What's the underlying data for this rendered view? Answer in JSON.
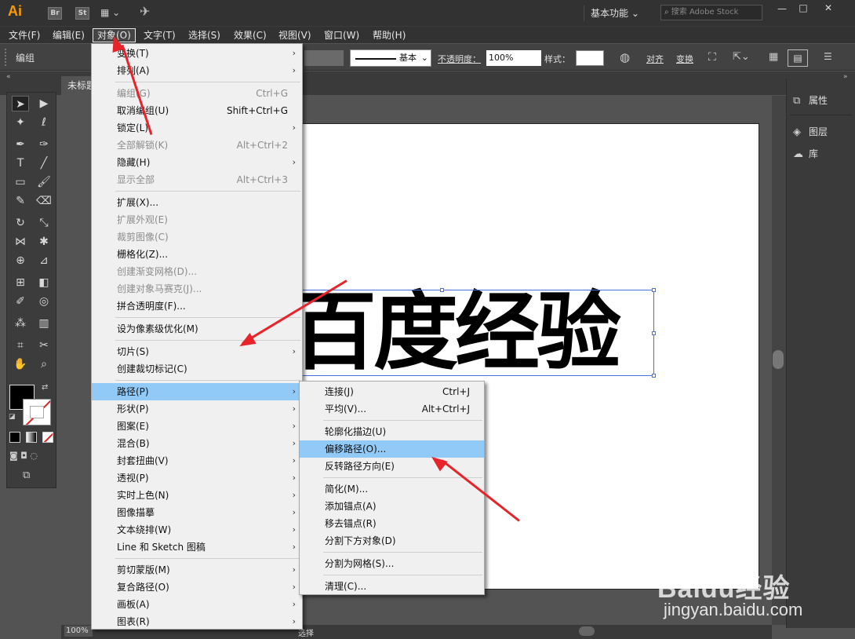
{
  "app": {
    "logo": "Ai",
    "br": "Br",
    "st": "St",
    "workspace": "基本功能",
    "search_placeholder": "搜索 Adobe Stock",
    "min": "—",
    "max": "□",
    "close": "✕"
  },
  "menubar": [
    "文件(F)",
    "编辑(E)",
    "对象(O)",
    "文字(T)",
    "选择(S)",
    "效果(C)",
    "视图(V)",
    "窗口(W)",
    "帮助(H)"
  ],
  "control": {
    "label": "编组",
    "stroke": "基本",
    "opacity_label": "不透明度：",
    "opacity": "100%",
    "style_label": "样式：",
    "align": "对齐",
    "transform": "变换"
  },
  "document": {
    "tab": "未标题",
    "zoom": "100%",
    "status": "选择"
  },
  "artwork_text": "百度经验",
  "right_panel": [
    {
      "icon": "properties-icon",
      "label": "属性"
    },
    {
      "icon": "layers-icon",
      "label": "图层"
    },
    {
      "icon": "libraries-icon",
      "label": "库"
    }
  ],
  "object_menu": [
    {
      "label": "变换(T)",
      "sub": true
    },
    {
      "label": "排列(A)",
      "sub": true
    },
    {
      "sep": true
    },
    {
      "label": "编组(G)",
      "shortcut": "Ctrl+G",
      "disabled": true
    },
    {
      "label": "取消编组(U)",
      "shortcut": "Shift+Ctrl+G"
    },
    {
      "label": "锁定(L)",
      "sub": true
    },
    {
      "label": "全部解锁(K)",
      "shortcut": "Alt+Ctrl+2",
      "disabled": true
    },
    {
      "label": "隐藏(H)",
      "sub": true
    },
    {
      "label": "显示全部",
      "shortcut": "Alt+Ctrl+3",
      "disabled": true
    },
    {
      "sep": true
    },
    {
      "label": "扩展(X)..."
    },
    {
      "label": "扩展外观(E)",
      "disabled": true
    },
    {
      "label": "裁剪图像(C)",
      "disabled": true
    },
    {
      "label": "栅格化(Z)..."
    },
    {
      "label": "创建渐变网格(D)...",
      "disabled": true
    },
    {
      "label": "创建对象马赛克(J)...",
      "disabled": true
    },
    {
      "label": "拼合透明度(F)..."
    },
    {
      "sep": true
    },
    {
      "label": "设为像素级优化(M)"
    },
    {
      "sep": true
    },
    {
      "label": "切片(S)",
      "sub": true
    },
    {
      "label": "创建裁切标记(C)"
    },
    {
      "sep": true
    },
    {
      "label": "路径(P)",
      "sub": true,
      "highlight": true
    },
    {
      "label": "形状(P)",
      "sub": true
    },
    {
      "label": "图案(E)",
      "sub": true
    },
    {
      "label": "混合(B)",
      "sub": true
    },
    {
      "label": "封套扭曲(V)",
      "sub": true
    },
    {
      "label": "透视(P)",
      "sub": true
    },
    {
      "label": "实时上色(N)",
      "sub": true
    },
    {
      "label": "图像描摹",
      "sub": true
    },
    {
      "label": "文本绕排(W)",
      "sub": true
    },
    {
      "label": "Line 和 Sketch 图稿",
      "sub": true
    },
    {
      "sep": true
    },
    {
      "label": "剪切蒙版(M)",
      "sub": true
    },
    {
      "label": "复合路径(O)",
      "sub": true
    },
    {
      "label": "画板(A)",
      "sub": true
    },
    {
      "label": "图表(R)",
      "sub": true
    }
  ],
  "path_menu": [
    {
      "label": "连接(J)",
      "shortcut": "Ctrl+J"
    },
    {
      "label": "平均(V)...",
      "shortcut": "Alt+Ctrl+J"
    },
    {
      "sep": true
    },
    {
      "label": "轮廓化描边(U)"
    },
    {
      "label": "偏移路径(O)...",
      "highlight": true
    },
    {
      "label": "反转路径方向(E)"
    },
    {
      "sep": true
    },
    {
      "label": "简化(M)..."
    },
    {
      "label": "添加锚点(A)"
    },
    {
      "label": "移去锚点(R)"
    },
    {
      "label": "分割下方对象(D)"
    },
    {
      "sep": true
    },
    {
      "label": "分割为网格(S)..."
    },
    {
      "sep": true
    },
    {
      "label": "清理(C)..."
    }
  ],
  "watermark": {
    "brand": "Baidu经验",
    "url": "jingyan.baidu.com"
  }
}
